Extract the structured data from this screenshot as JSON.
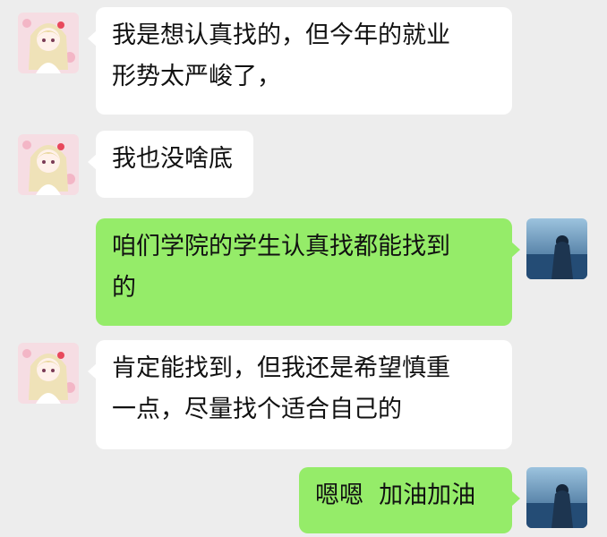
{
  "messages": [
    {
      "side": "in",
      "lines": [
        "我是想认真找的，但今年的就业",
        "形势太严峻了，"
      ],
      "avatar": "anime-girl-avatar"
    },
    {
      "side": "in",
      "lines": [
        "我也没啥底"
      ],
      "avatar": "anime-girl-avatar"
    },
    {
      "side": "out",
      "lines": [
        "咱们学院的学生认真找都能找到",
        "的"
      ],
      "avatar": "girl-by-sea-avatar"
    },
    {
      "side": "in",
      "lines": [
        "肯定能找到，但我还是希望慎重",
        "一点，尽量找个适合自己的"
      ],
      "avatar": "anime-girl-avatar"
    },
    {
      "side": "out",
      "lines": [
        "嗯嗯  加油加油"
      ],
      "avatar": "girl-by-sea-avatar"
    }
  ],
  "colors": {
    "background": "#ededed",
    "incoming_bubble": "#ffffff",
    "outgoing_bubble": "#95ec69"
  }
}
